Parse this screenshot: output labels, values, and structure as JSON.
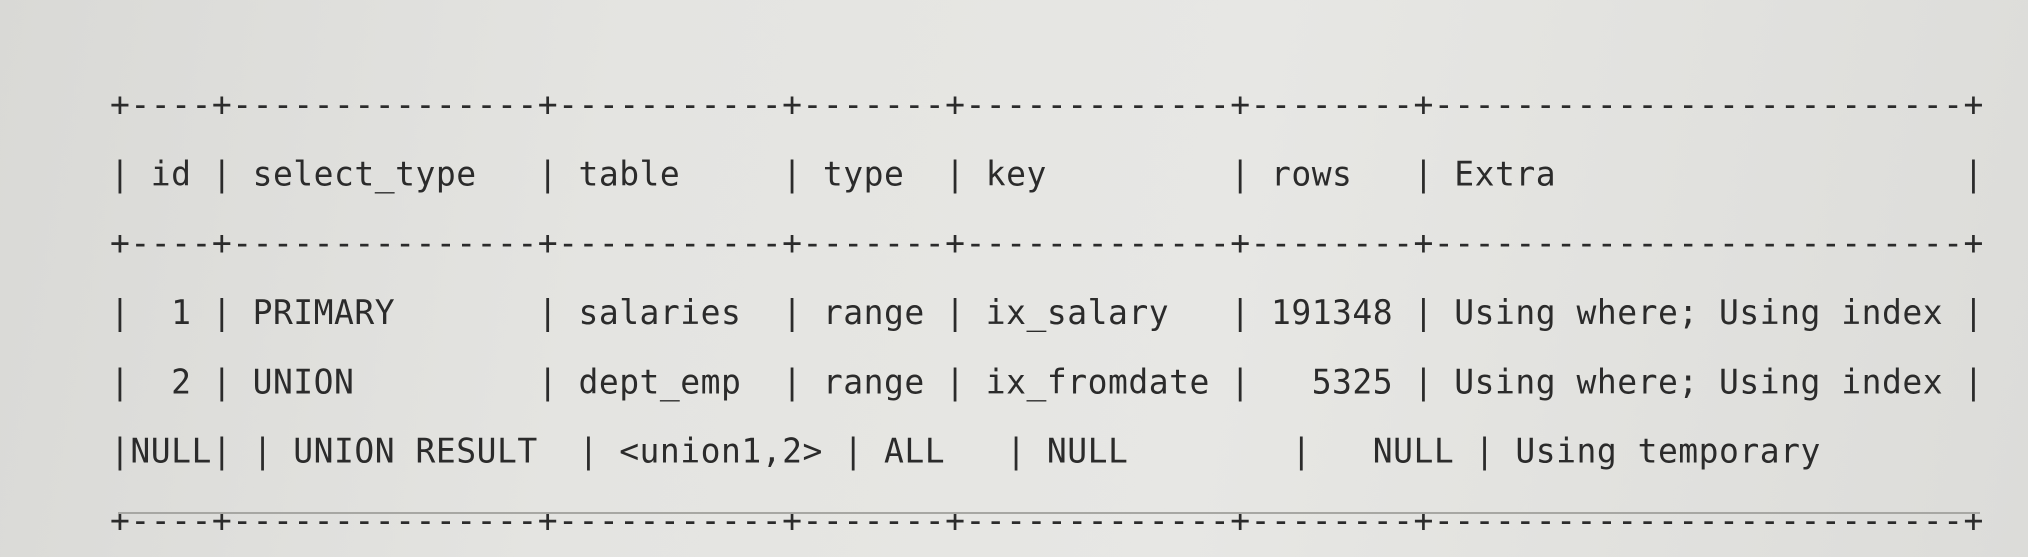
{
  "table": {
    "border": "+----+---------------+-----------+-------+-------------+--------+--------------------------+",
    "columns": [
      "id",
      "select_type",
      "table",
      "type",
      "key",
      "rows",
      "Extra"
    ],
    "rows": [
      {
        "id": "1",
        "select_type": "PRIMARY",
        "table": "salaries",
        "type": "range",
        "key": "ix_salary",
        "rows": "191348",
        "extra": "Using where; Using index"
      },
      {
        "id": "2",
        "select_type": "UNION",
        "table": "dept_emp",
        "type": "range",
        "key": "ix_fromdate",
        "rows": "5325",
        "extra": "Using where; Using index"
      },
      {
        "id": "NULL",
        "select_type": "UNION RESULT",
        "table": "<union1,2>",
        "type": "ALL",
        "key": "NULL",
        "rows": "NULL",
        "extra": "Using temporary"
      }
    ]
  }
}
